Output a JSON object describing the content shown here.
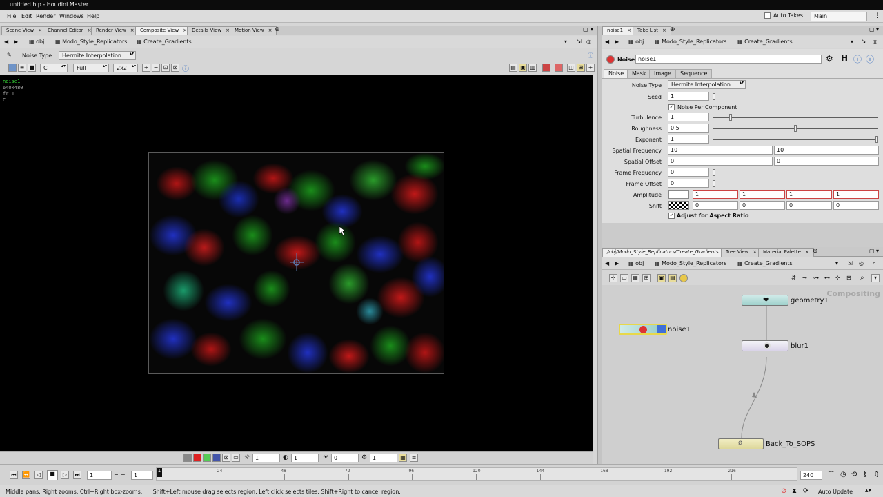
{
  "window": {
    "title": "untitled.hip - Houdini Master"
  },
  "menu": {
    "items": [
      "File",
      "Edit",
      "Render",
      "Windows",
      "Help"
    ],
    "auto_takes": "Auto Takes",
    "desktop": "Main"
  },
  "left_pane": {
    "tabs": [
      "Scene View",
      "Channel Editor",
      "Render View",
      "Composite View",
      "Details View",
      "Motion View"
    ],
    "active_tab": "Composite View",
    "path": {
      "root": "obj",
      "crumb1": "Modo_Style_Replicators",
      "crumb2": "Create_Gradients"
    },
    "op_toolbar": {
      "label": "Noise Type",
      "value": "Hermite Interpolation"
    },
    "view_toolbar": {
      "channel": "C",
      "resolution": "Full",
      "tile": "2x2"
    },
    "viewer_info": {
      "name": "noise1",
      "res": "640x480",
      "frame": "fr 1",
      "chan": "C"
    },
    "bottom_bar": {
      "f1": "1",
      "f2": "1",
      "f3": "0",
      "f4": "1"
    }
  },
  "param_pane": {
    "tabs": [
      "noise1",
      "Take List"
    ],
    "path": {
      "root": "obj",
      "crumb1": "Modo_Style_Replicators",
      "crumb2": "Create_Gradients"
    },
    "op_type": "Noise",
    "op_name": "noise1",
    "subtabs": [
      "Noise",
      "Mask",
      "Image",
      "Sequence"
    ],
    "params": {
      "noise_type": {
        "label": "Noise Type",
        "value": "Hermite Interpolation"
      },
      "seed": {
        "label": "Seed",
        "value": "1"
      },
      "noise_per_component": {
        "label": "Noise Per Component",
        "checked": "✓"
      },
      "turbulence": {
        "label": "Turbulence",
        "value": "1",
        "slider": 0.1
      },
      "roughness": {
        "label": "Roughness",
        "value": "0.5",
        "slider": 0.5
      },
      "exponent": {
        "label": "Exponent",
        "value": "1",
        "slider": 1.0
      },
      "spatial_frequency": {
        "label": "Spatial Frequency",
        "v1": "10",
        "v2": "10"
      },
      "spatial_offset": {
        "label": "Spatial Offset",
        "v1": "0",
        "v2": "0"
      },
      "frame_frequency": {
        "label": "Frame Frequency",
        "value": "0",
        "slider": 0
      },
      "frame_offset": {
        "label": "Frame Offset",
        "value": "0",
        "slider": 0
      },
      "amplitude": {
        "label": "Amplitude",
        "v1": "1",
        "v2": "1",
        "v3": "1",
        "v4": "1"
      },
      "shift": {
        "label": "Shift",
        "v1": "0",
        "v2": "0",
        "v3": "0",
        "v4": "0"
      },
      "adjust_aspect": {
        "label": "Adjust for Aspect Ratio",
        "checked": "✓"
      }
    }
  },
  "network_pane": {
    "tabs": [
      "/obj/Modo_Style_Replicators/Create_Gradients",
      "Tree View",
      "Material Palette"
    ],
    "path": {
      "root": "obj",
      "crumb1": "Modo_Style_Replicators",
      "crumb2": "Create_Gradients"
    },
    "context": "Compositing",
    "nodes": {
      "geometry": "geometry1",
      "noise": "noise1",
      "blur": "blur1",
      "sops": "Back_To_SOPS"
    }
  },
  "timeline": {
    "current_frame": "1",
    "start_frame": "1",
    "end_frame": "240",
    "ticks": [
      "24",
      "48",
      "72",
      "96",
      "120",
      "144",
      "168",
      "192",
      "216"
    ],
    "marker": "1"
  },
  "status": {
    "message": "Middle pans. Right zooms. Ctrl+Right box-zooms.      Shift+Left mouse drag selects region. Left click selects tiles. Shift+Right to cancel region.",
    "auto_update": "Auto Update"
  },
  "colors": {
    "viewer_bg": "#000000",
    "node_selected": "#e8d84a",
    "info_green": "#36d536"
  }
}
